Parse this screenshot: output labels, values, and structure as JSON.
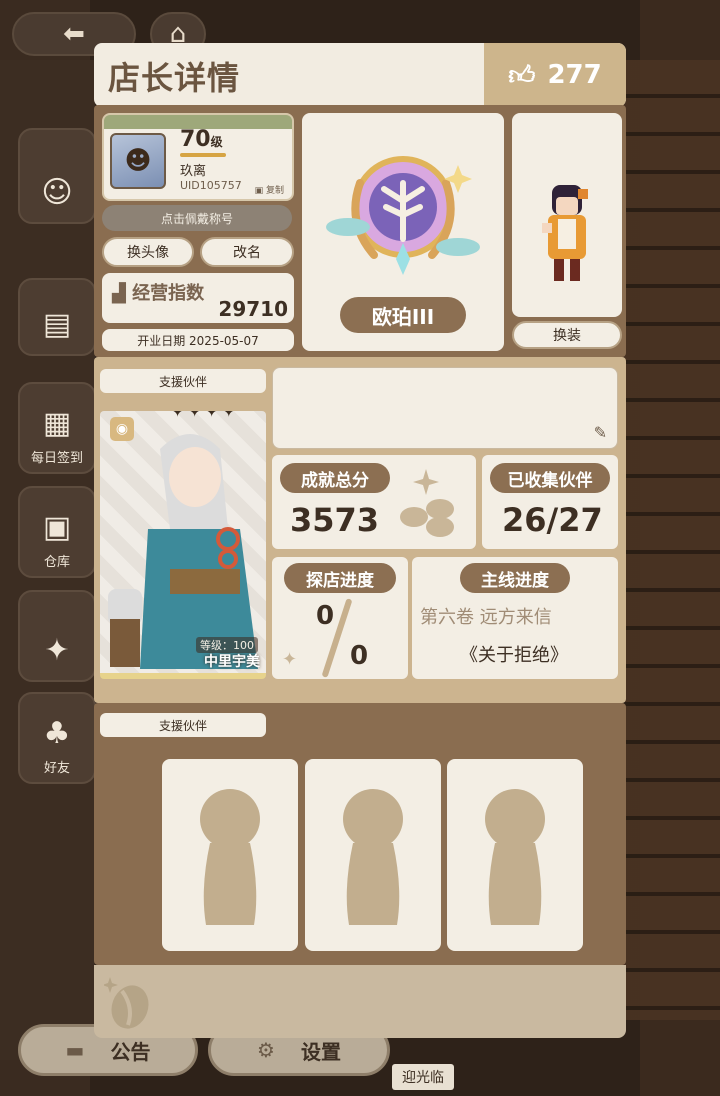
{
  "background": {
    "side_buttons": [
      {
        "label": "",
        "icon": "avatar-icon"
      },
      {
        "label": "",
        "icon": "book-icon"
      },
      {
        "label": "每日签到",
        "icon": "calendar-icon"
      },
      {
        "label": "仓库",
        "icon": "box-icon"
      },
      {
        "label": "",
        "icon": "party-icon"
      },
      {
        "label": "好友",
        "icon": "cats-icon"
      }
    ],
    "bottom": {
      "notice": "公告",
      "settings": "设置"
    },
    "welcome": "迎光临"
  },
  "panel": {
    "title": "店长详情",
    "likes": "277",
    "profile": {
      "level": "70",
      "level_unit": "级",
      "name": "玖离",
      "uid": "UID105757",
      "copy": "复制"
    },
    "wear_title_btn": "点击佩戴称号",
    "change_avatar_btn": "换头像",
    "rename_btn": "改名",
    "business_index_label": "经营指数",
    "business_index_value": "29710",
    "open_date": "开业日期 2025-05-07",
    "rank": "欧珀III",
    "dress_btn": "换装",
    "support_partner_label": "支援伙伴",
    "partner": {
      "level": "等级：100",
      "name": "中里宇美",
      "stars": "✦✦✦✦"
    },
    "achievement_label": "成就总分",
    "achievement_value": "3573",
    "collected_label": "已收集伙伴",
    "collected_value": "26/27",
    "explore_label": "探店进度",
    "explore_num": "0",
    "explore_den": "0",
    "mainline_label": "主线进度",
    "mainline_chapter": "第六卷 远方来信",
    "mainline_title": "《关于拒绝》",
    "support_partner_label2": "支援伙伴"
  },
  "colors": {
    "accent_brown": "#8c6f52",
    "card_bg": "#f3eee4",
    "gold": "#cdb58c"
  }
}
